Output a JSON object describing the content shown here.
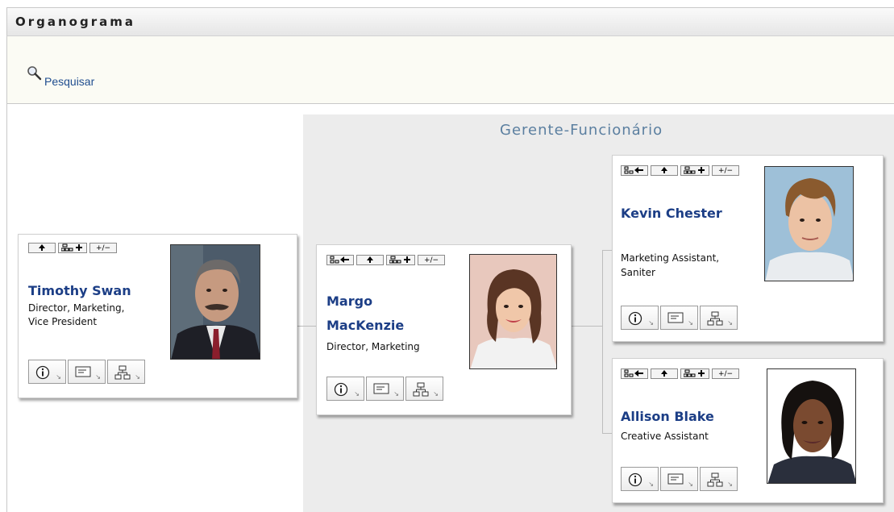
{
  "window": {
    "title": "Organograma"
  },
  "toolbar": {
    "search_label": "Pesquisar",
    "search_icon": "magnifier-icon"
  },
  "view": {
    "title": "Gerente-Funcionário"
  },
  "nav_labels": {
    "toggle": "+/−"
  },
  "people": [
    {
      "name": "Timothy Swan",
      "title_line1": "Director, Marketing,",
      "title_line2": "Vice President"
    },
    {
      "name_line1": "Margo",
      "name_line2": "MacKenzie",
      "title_line1": "Director, Marketing"
    },
    {
      "name": "Kevin Chester",
      "title_line1": "Marketing Assistant,",
      "title_line2": "Saniter"
    },
    {
      "name": "Allison Blake",
      "title_line1": "Creative Assistant"
    }
  ],
  "icons": {
    "info": "info-icon",
    "email": "email-card-icon",
    "orgchart": "org-chart-icon",
    "up": "up-arrow-icon",
    "expand": "expand-subordinates-icon",
    "back": "back-to-root-icon"
  }
}
